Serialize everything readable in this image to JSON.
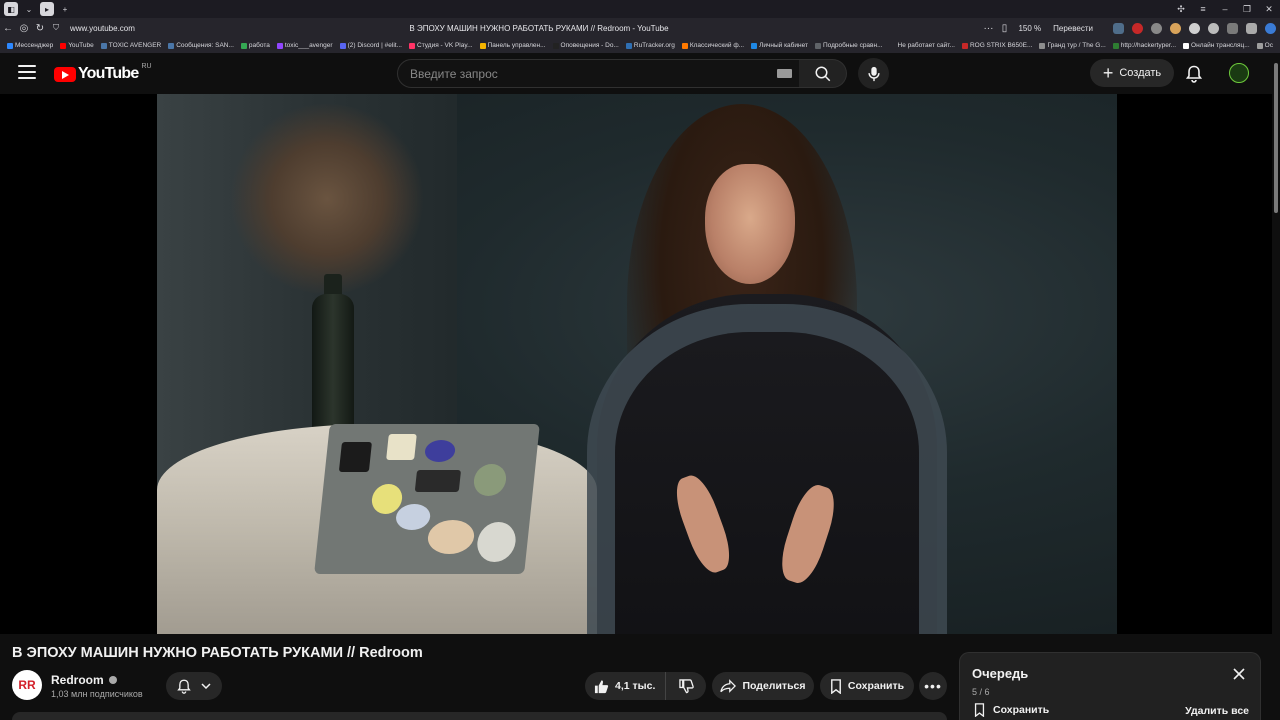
{
  "browser": {
    "url": "www.youtube.com",
    "page_title": "В ЭПОХУ МАШИН НУЖНО РАБОТАТЬ РУКАМИ // Redroom - YouTube",
    "zoom": "150 %",
    "translate": "Перевести",
    "bookmarks": [
      {
        "label": "Мессенджер",
        "color": "#2d88ff"
      },
      {
        "label": "YouTube",
        "color": "#ff0000"
      },
      {
        "label": "TOXIC AVENGER",
        "color": "#4a76a8"
      },
      {
        "label": "Сообщения: SAN...",
        "color": "#4a76a8"
      },
      {
        "label": "работа",
        "color": "#34a853"
      },
      {
        "label": "toxic___avenger",
        "color": "#9146ff"
      },
      {
        "label": "(2) Discord | #elit...",
        "color": "#5865f2"
      },
      {
        "label": "Студия - VK Play...",
        "color": "#ff3366"
      },
      {
        "label": "Панель управлен...",
        "color": "#f4b400"
      },
      {
        "label": "Оповещения - Do...",
        "color": "#222222"
      },
      {
        "label": "RuTracker.org",
        "color": "#2f6fb3"
      },
      {
        "label": "Классический ф...",
        "color": "#ff7a00"
      },
      {
        "label": "Личный кабинет",
        "color": "#1e88e5"
      },
      {
        "label": "Подробные сравн...",
        "color": "#5f6368"
      },
      {
        "label": "Не работает сайт...",
        "color": "#26252c"
      },
      {
        "label": "ROG STRIX B650E...",
        "color": "#c62828"
      },
      {
        "label": "Гранд тур / The G...",
        "color": "#8e8e8e"
      },
      {
        "label": "http://hackertyper...",
        "color": "#2e7d32"
      },
      {
        "label": "Онлайн трансляц...",
        "color": "#ffffff"
      },
      {
        "label": "Ос",
        "color": "#9e9e9e"
      }
    ]
  },
  "header": {
    "logo_text": "YouTube",
    "logo_region": "RU",
    "search_placeholder": "Введите запрос",
    "create_label": "Создать"
  },
  "video": {
    "title": "В ЭПОХУ МАШИН НУЖНО РАБОТАТЬ РУКАМИ // Redroom"
  },
  "channel": {
    "avatar_text": "RR",
    "name": "Redroom",
    "subscribers": "1,03 млн подписчиков"
  },
  "actions": {
    "likes": "4,1 тыс.",
    "share_label": "Поделиться",
    "save_label": "Сохранить",
    "more_label": "•••"
  },
  "queue": {
    "title": "Очередь",
    "count": "5 / 6",
    "save_label": "Сохранить",
    "delete_label": "Удалить все"
  },
  "colors": {
    "brand_red": "#ff0000",
    "background": "#0f0f0f",
    "button_bg": "#272727"
  }
}
